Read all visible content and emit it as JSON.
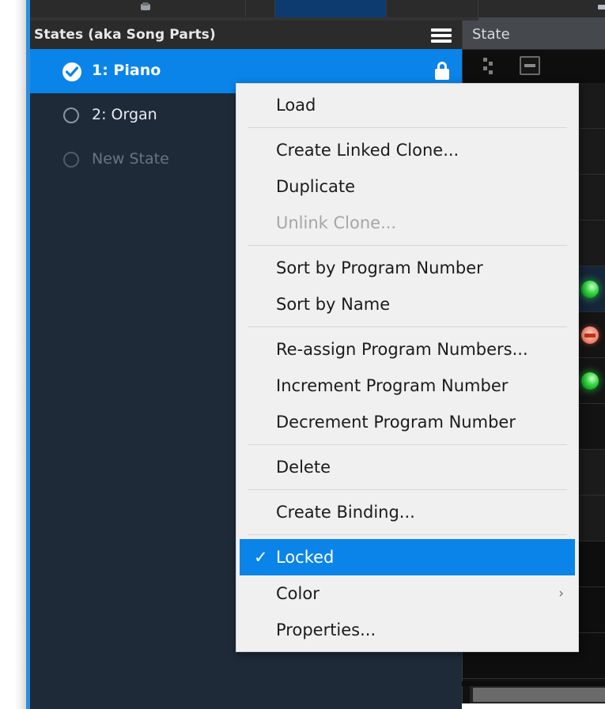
{
  "toolbar": {
    "save_icon": "save-icon",
    "window_controls_icon": "window-controls-icon"
  },
  "states_panel": {
    "title": "States (aka Song Parts)",
    "menu_icon": "hamburger-menu-icon",
    "rows": [
      {
        "label": "1: Piano",
        "selected": true,
        "placeholder": false,
        "locked": true
      },
      {
        "label": "2: Organ",
        "selected": false,
        "placeholder": false,
        "locked": false
      },
      {
        "label": "New State",
        "selected": false,
        "placeholder": true,
        "locked": false
      }
    ]
  },
  "right_panel": {
    "title": "State",
    "drag_handle_icon": "drag-dots-icon",
    "collapse_icon": "minus-icon",
    "rows": [
      {
        "led": "none"
      },
      {
        "led": "none"
      },
      {
        "led": "none"
      },
      {
        "led": "none"
      },
      {
        "led": "green"
      },
      {
        "led": "red"
      },
      {
        "led": "green"
      },
      {
        "led": "none"
      }
    ]
  },
  "context_menu": {
    "items": [
      {
        "label": "Load",
        "type": "item",
        "state": "normal"
      },
      {
        "label": "",
        "type": "separator"
      },
      {
        "label": "Create Linked Clone...",
        "type": "item",
        "state": "normal"
      },
      {
        "label": "Duplicate",
        "type": "item",
        "state": "normal"
      },
      {
        "label": "Unlink Clone...",
        "type": "item",
        "state": "disabled"
      },
      {
        "label": "",
        "type": "separator"
      },
      {
        "label": "Sort by Program Number",
        "type": "item",
        "state": "normal"
      },
      {
        "label": "Sort by Name",
        "type": "item",
        "state": "normal"
      },
      {
        "label": "",
        "type": "separator"
      },
      {
        "label": "Re-assign Program Numbers...",
        "type": "item",
        "state": "normal"
      },
      {
        "label": "Increment Program Number",
        "type": "item",
        "state": "normal"
      },
      {
        "label": "Decrement Program Number",
        "type": "item",
        "state": "normal"
      },
      {
        "label": "",
        "type": "separator"
      },
      {
        "label": "Delete",
        "type": "item",
        "state": "normal"
      },
      {
        "label": "",
        "type": "separator"
      },
      {
        "label": "Create Binding...",
        "type": "item",
        "state": "normal"
      },
      {
        "label": "",
        "type": "separator"
      },
      {
        "label": "Locked",
        "type": "item",
        "state": "highlighted",
        "checked": true,
        "check_glyph": "✓"
      },
      {
        "label": "Color",
        "type": "item",
        "state": "normal",
        "submenu": true,
        "arrow_glyph": "›"
      },
      {
        "label": "Properties...",
        "type": "item",
        "state": "normal"
      }
    ]
  },
  "colors": {
    "accent_blue": "#0a84e8",
    "panel_dark": "#1e2a38",
    "menu_bg": "#f0f0f0",
    "header_dark": "#2b2b2b",
    "right_header": "#45484d",
    "led_green": "#3ddb4a",
    "led_red": "#d9543a"
  },
  "scrollbar": {
    "name": "horizontal-scrollbar"
  }
}
